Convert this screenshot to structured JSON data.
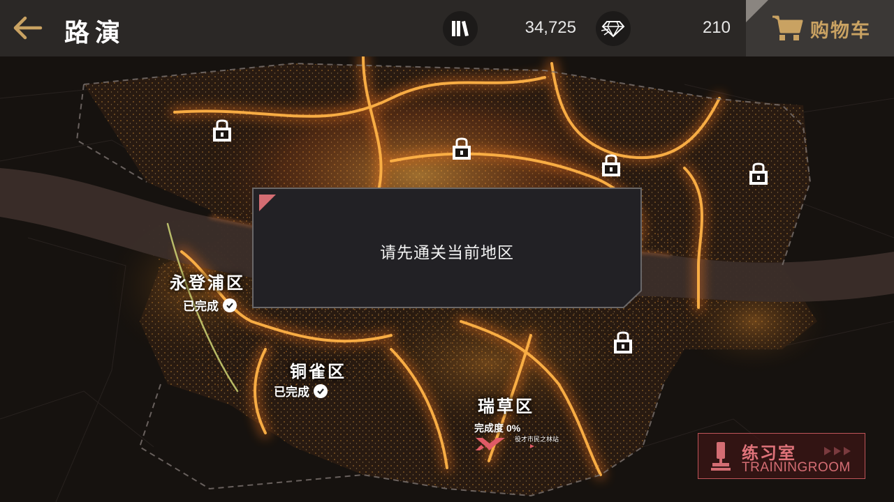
{
  "header": {
    "title": "路演",
    "currency1_icon": "books-icon",
    "currency1_value": "34,725",
    "currency2_icon": "diamond-icon",
    "currency2_value": "210",
    "cart_icon": "shopping-cart-icon",
    "cart_label": "购物车"
  },
  "districts": [
    {
      "name": "永登浦区",
      "status": "已完成"
    },
    {
      "name": "铜雀区",
      "status": "已完成"
    },
    {
      "name": "瑞草区",
      "progress_label": "完成度",
      "progress_value": "0%",
      "sub_caption": "役才市民之林站"
    }
  ],
  "dialog": {
    "message": "请先通关当前地区"
  },
  "training_room": {
    "label_cn": "练习室",
    "label_en": "TRAININGROOM"
  },
  "colors": {
    "accent_gold": "#c9a262",
    "accent_red": "#d46d73",
    "topbar": "#2b2826"
  }
}
